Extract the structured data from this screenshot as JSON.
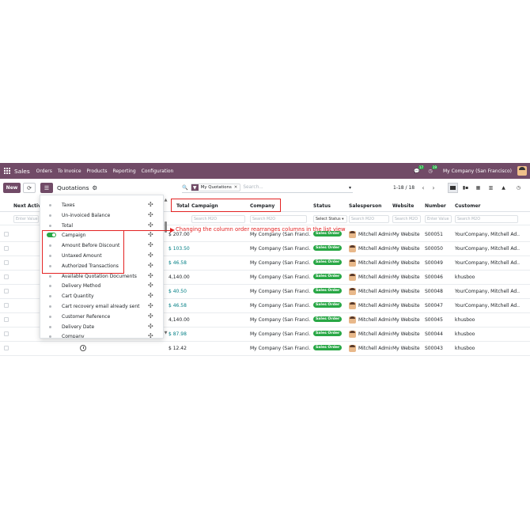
{
  "navbar": {
    "app_name": "Sales",
    "menu": [
      "Orders",
      "To Invoice",
      "Products",
      "Reporting",
      "Configuration"
    ],
    "chat_badge": "17",
    "activity_badge": "19",
    "company": "My Company (San Francisco)"
  },
  "control": {
    "new_label": "New",
    "title": "Quotations",
    "facet_label": "My Quotations",
    "search_placeholder": "Search...",
    "pager": "1-18 / 18"
  },
  "columns": {
    "next_activity": "Next Activiti",
    "total": "Total",
    "campaign": "Campaign",
    "company": "Company",
    "status": "Status",
    "salesperson": "Salesperson",
    "website": "Website",
    "number": "Number",
    "customer": "Customer"
  },
  "filters": {
    "enter_value": "Enter Value",
    "search_m2o": "Search M2O",
    "select_status": "Select Status",
    "enter_value_number": "Enter Value"
  },
  "dropdown": {
    "items": [
      {
        "label": "Taxes",
        "enabled": false
      },
      {
        "label": "Un-invoiced Balance",
        "enabled": false
      },
      {
        "label": "Total",
        "enabled": false
      },
      {
        "label": "Campaign",
        "enabled": true
      },
      {
        "label": "Amount Before Discount",
        "enabled": false
      },
      {
        "label": "Untaxed Amount",
        "enabled": false
      },
      {
        "label": "Authorized Transactions",
        "enabled": false
      },
      {
        "label": "Available Quotation Documents",
        "enabled": false
      },
      {
        "label": "Delivery Method",
        "enabled": false
      },
      {
        "label": "Cart Quantity",
        "enabled": false
      },
      {
        "label": "Cart recovery email already sent",
        "enabled": false
      },
      {
        "label": "Customer Reference",
        "enabled": false
      },
      {
        "label": "Delivery Date",
        "enabled": false
      },
      {
        "label": "Company",
        "enabled": false
      }
    ]
  },
  "annotation": "Changing the column order rearranges columns in the list view",
  "rows": [
    {
      "total": "$ 207.00",
      "total_blue": false,
      "company": "My Company (San Franci...",
      "status": "Sales Order",
      "salesperson": "Mitchell Admin",
      "website": "My Website",
      "number": "S00051",
      "customer": "YourCompany, Mitchell Ad..."
    },
    {
      "total": "$ 103.50",
      "total_blue": true,
      "company": "My Company (San Franci...",
      "status": "Sales Order",
      "salesperson": "Mitchell Admin",
      "website": "My Website",
      "number": "S00050",
      "customer": "YourCompany, Mitchell Ad..."
    },
    {
      "total": "$ 46.58",
      "total_blue": true,
      "company": "My Company (San Franci...",
      "status": "Sales Order",
      "salesperson": "Mitchell Admin",
      "website": "My Website",
      "number": "S00049",
      "customer": "YourCompany, Mitchell Ad..."
    },
    {
      "total": "4,140.00",
      "total_blue": false,
      "company": "My Company (San Franci...",
      "status": "Sales Order",
      "salesperson": "Mitchell Admin",
      "website": "My Website",
      "number": "S00046",
      "customer": "khusboo"
    },
    {
      "total": "$ 40.50",
      "total_blue": true,
      "company": "My Company (San Franci...",
      "status": "Sales Order",
      "salesperson": "Mitchell Admin",
      "website": "My Website",
      "number": "S00048",
      "customer": "YourCompany, Mitchell Ad..."
    },
    {
      "total": "$ 46.58",
      "total_blue": true,
      "company": "My Company (San Franci...",
      "status": "Sales Order",
      "salesperson": "Mitchell Admin",
      "website": "My Website",
      "number": "S00047",
      "customer": "YourCompany, Mitchell Ad..."
    },
    {
      "total": "4,140.00",
      "total_blue": false,
      "company": "My Company (San Franci...",
      "status": "Sales Order",
      "salesperson": "Mitchell Admin",
      "website": "My Website",
      "number": "S00045",
      "customer": "khusboo"
    },
    {
      "total": "$ 87.98",
      "total_blue": true,
      "company": "My Company (San Franci...",
      "status": "Sales Order",
      "salesperson": "Mitchell Admin",
      "website": "My Website",
      "number": "S00044",
      "customer": "khusboo"
    },
    {
      "total": "$ 12.42",
      "total_blue": false,
      "company": "My Company (San Franci...",
      "status": "Sales Order",
      "salesperson": "Mitchell Admin",
      "website": "My Website",
      "number": "S00043",
      "customer": "khusboo"
    }
  ],
  "colors": {
    "brand": "#714b67",
    "status_green": "#28a745",
    "annotation_red": "#e32222"
  }
}
